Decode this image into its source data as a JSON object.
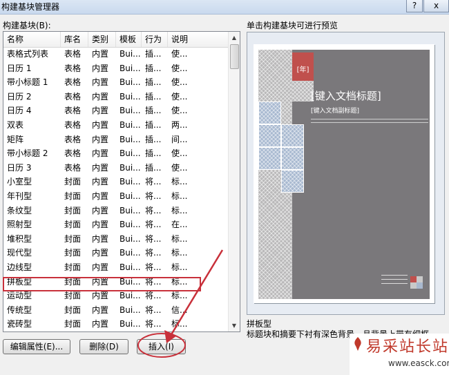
{
  "window": {
    "title": "构建基块管理器",
    "help_label": "?",
    "close_label": "x"
  },
  "list_label": "构建基块(B):",
  "columns": [
    "名称",
    "库名",
    "类别",
    "模板",
    "行为",
    "说明"
  ],
  "rows": [
    [
      "表格式列表",
      "表格",
      "内置",
      "Bui...",
      "插...",
      "使..."
    ],
    [
      "日历 1",
      "表格",
      "内置",
      "Bui...",
      "插...",
      "使..."
    ],
    [
      "带小标题 1",
      "表格",
      "内置",
      "Bui...",
      "插...",
      "使..."
    ],
    [
      "日历 2",
      "表格",
      "内置",
      "Bui...",
      "插...",
      "使..."
    ],
    [
      "日历 4",
      "表格",
      "内置",
      "Bui...",
      "插...",
      "使..."
    ],
    [
      "双表",
      "表格",
      "内置",
      "Bui...",
      "插...",
      "两..."
    ],
    [
      "矩阵",
      "表格",
      "内置",
      "Bui...",
      "插...",
      "间..."
    ],
    [
      "带小标题 2",
      "表格",
      "内置",
      "Bui...",
      "插...",
      "使..."
    ],
    [
      "日历 3",
      "表格",
      "内置",
      "Bui...",
      "插...",
      "使..."
    ],
    [
      "小室型",
      "封面",
      "内置",
      "Bui...",
      "将...",
      "标..."
    ],
    [
      "年刊型",
      "封面",
      "内置",
      "Bui...",
      "将...",
      "标..."
    ],
    [
      "条纹型",
      "封面",
      "内置",
      "Bui...",
      "将...",
      "标..."
    ],
    [
      "照射型",
      "封面",
      "内置",
      "Bui...",
      "将...",
      "在..."
    ],
    [
      "堆积型",
      "封面",
      "内置",
      "Bui...",
      "将...",
      "标..."
    ],
    [
      "现代型",
      "封面",
      "内置",
      "Bui...",
      "将...",
      "标..."
    ],
    [
      "边线型",
      "封面",
      "内置",
      "Bui...",
      "将...",
      "标..."
    ],
    [
      "拼板型",
      "封面",
      "内置",
      "Bui...",
      "将...",
      "标..."
    ],
    [
      "运动型",
      "封面",
      "内置",
      "Bui...",
      "将...",
      "标..."
    ],
    [
      "传统型",
      "封面",
      "内置",
      "Bui...",
      "将...",
      "信..."
    ],
    [
      "瓷砖型",
      "封面",
      "内置",
      "Bui...",
      "将...",
      "标..."
    ]
  ],
  "buttons": {
    "edit": "编辑属性(E)...",
    "delete": "删除(D)",
    "insert": "插入(I)"
  },
  "preview": {
    "label": "单击构建基块可进行预览",
    "year": "[年]",
    "doc_title": "[键入文档标题]",
    "doc_subtitle": "[键入文档副标题]"
  },
  "description": {
    "name": "拼板型",
    "text": "标题块和摘要下衬有深色背景，且背景上带有细框"
  },
  "watermark": {
    "title": "易采站长站",
    "url": "www.easck.com"
  },
  "colors": {
    "highlight_box": "#c8303a",
    "accent": "#c0504d",
    "cover_gray": "#7a787b"
  }
}
